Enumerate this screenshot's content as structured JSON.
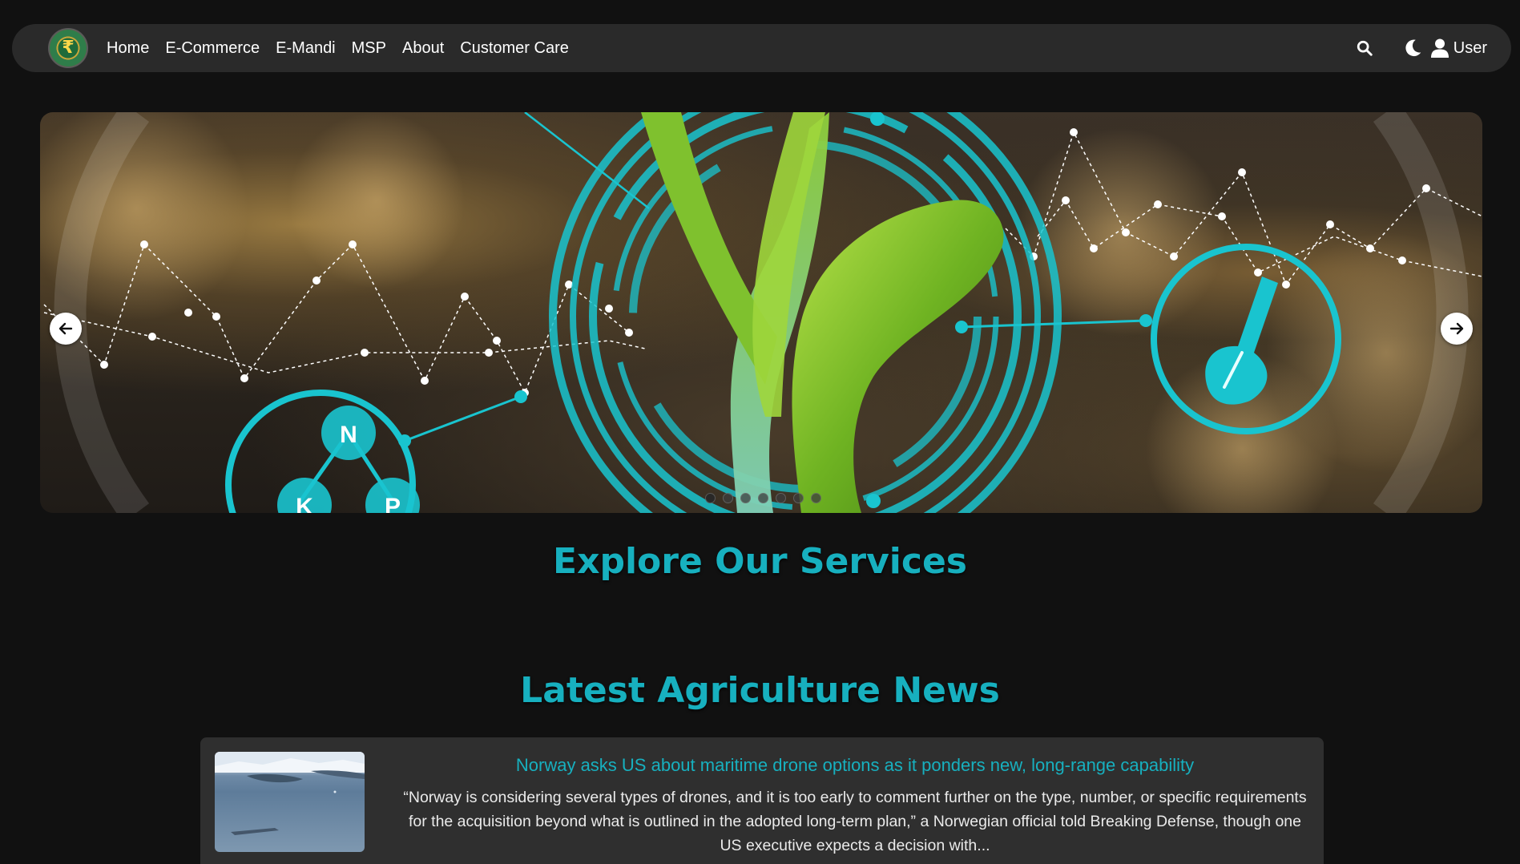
{
  "nav": {
    "logo_glyph": "₹",
    "links": [
      {
        "label": "Home"
      },
      {
        "label": "E-Commerce"
      },
      {
        "label": "E-Mandi"
      },
      {
        "label": "MSP"
      },
      {
        "label": "About"
      },
      {
        "label": "Customer Care"
      }
    ],
    "search_icon": "search-icon",
    "theme_icon": "moon-icon",
    "user_label": "User"
  },
  "hero": {
    "nutrient_labels": [
      "N",
      "K",
      "P"
    ],
    "slide_count": 7,
    "active_slide": 1,
    "accent_color": "#19c4cf"
  },
  "services": {
    "title": "Explore Our Services"
  },
  "news": {
    "title": "Latest Agriculture News",
    "items": [
      {
        "headline": "Norway asks US about maritime drone options as it ponders new, long-range capability",
        "excerpt": "“Norway is considering several types of drones, and it is too early to comment further on the type, number, or specific requirements for the acquisition beyond what is outlined in the adopted long-term plan,” a Norwegian official told Breaking Defense, though one US executive expects a decision with..."
      }
    ]
  },
  "colors": {
    "accent": "#17b0bf",
    "background": "#111111",
    "navbar": "#2a2a2a",
    "card": "#2f2f2f"
  }
}
